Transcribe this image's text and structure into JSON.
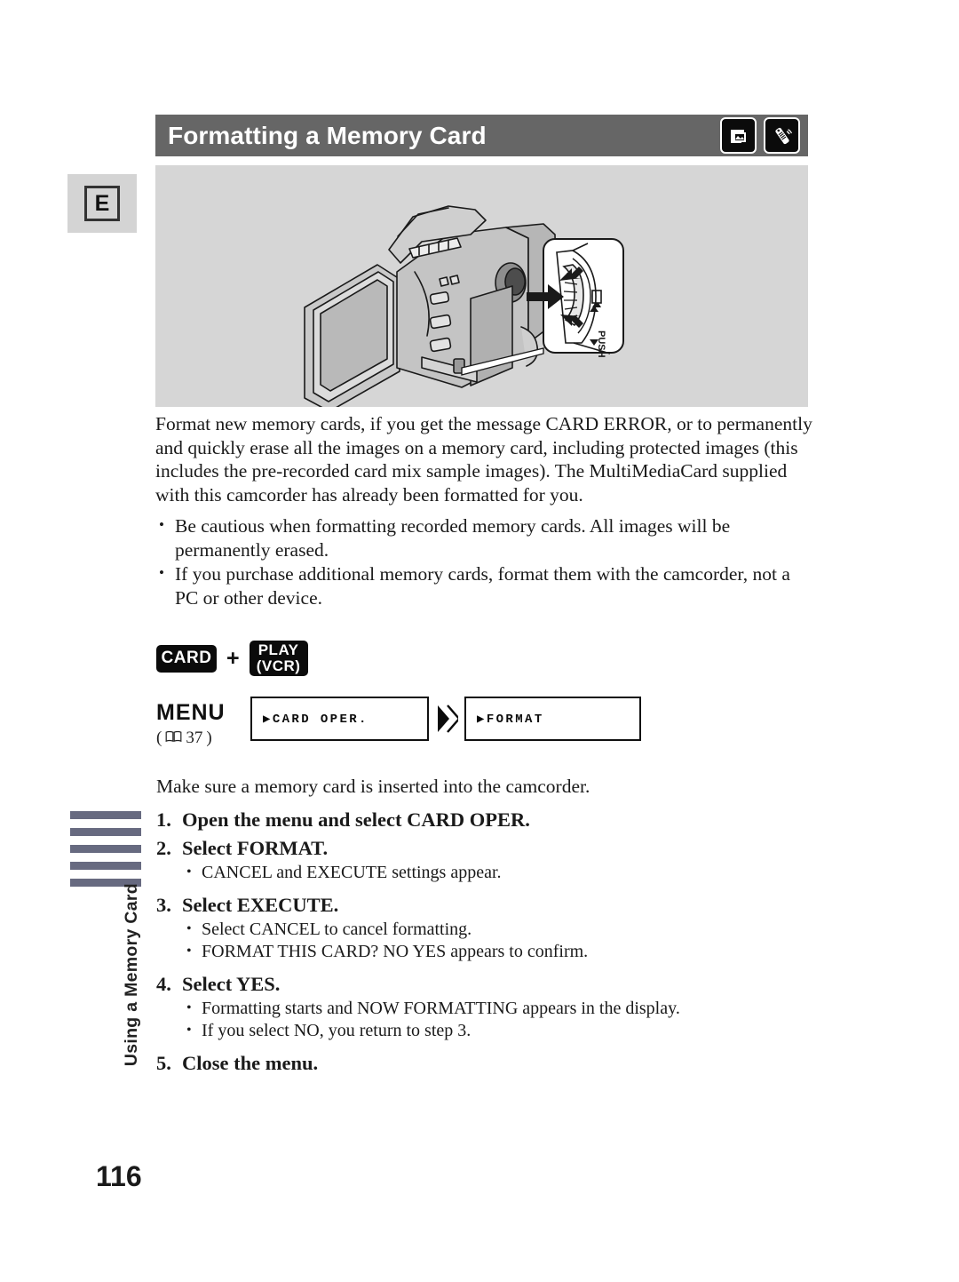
{
  "page": {
    "number": "116",
    "language_tab": "E",
    "side_tab_label": "Using a Memory Card",
    "side_bar_count": 5,
    "colors": {
      "header_bar": "#666666",
      "illustration_bg": "#d6d6d6",
      "side_bar": "#676a80",
      "key_button": "#0b0b0b"
    }
  },
  "header": {
    "title": "Formatting a Memory Card",
    "icons": [
      {
        "name": "memory-card-photo-icon",
        "label": "card"
      },
      {
        "name": "remote-control-icon",
        "label": "remote"
      }
    ]
  },
  "illustration": {
    "name": "camcorder-diagram",
    "callout_labels": [
      "PUSH"
    ]
  },
  "intro": {
    "paragraph": "Format new memory cards, if you get the message CARD ERROR, or to permanently and quickly erase all the images on a memory card, including protected images (this includes the pre-recorded card mix sample images). The MultiMediaCard supplied with this camcorder has already been formatted for you.",
    "bullets": [
      "Be cautious when formatting recorded memory cards. All images will be permanently erased.",
      "If you purchase additional memory cards, format them with the camcorder, not a PC or other device."
    ]
  },
  "controls": {
    "buttons": [
      {
        "name": "card-button",
        "label": "CARD"
      }
    ],
    "plus": "+",
    "play_button": {
      "line1": "PLAY",
      "line2": "(VCR)"
    }
  },
  "menu_flow": {
    "label": "MENU",
    "reference_open": "(",
    "reference_page": "37",
    "reference_close": ")",
    "steps": [
      {
        "name": "menu-screen-card-oper",
        "text": "▶CARD OPER."
      },
      {
        "name": "menu-screen-format",
        "text": "▶FORMAT"
      }
    ]
  },
  "procedure": {
    "intro": "Make sure a memory card is inserted into the camcorder.",
    "steps": [
      {
        "num": "1.",
        "title": "Open the menu and select CARD OPER.",
        "bullets": []
      },
      {
        "num": "2.",
        "title": "Select FORMAT.",
        "bullets": [
          "CANCEL and EXECUTE settings appear."
        ]
      },
      {
        "num": "3.",
        "title": "Select EXECUTE.",
        "bullets": [
          "Select CANCEL to cancel formatting.",
          "FORMAT THIS CARD? NO YES appears to confirm."
        ]
      },
      {
        "num": "4.",
        "title": "Select YES.",
        "bullets": [
          "Formatting starts and NOW FORMATTING appears in the display.",
          "If you select NO, you return to step 3."
        ]
      },
      {
        "num": "5.",
        "title": "Close the menu.",
        "bullets": []
      }
    ]
  }
}
